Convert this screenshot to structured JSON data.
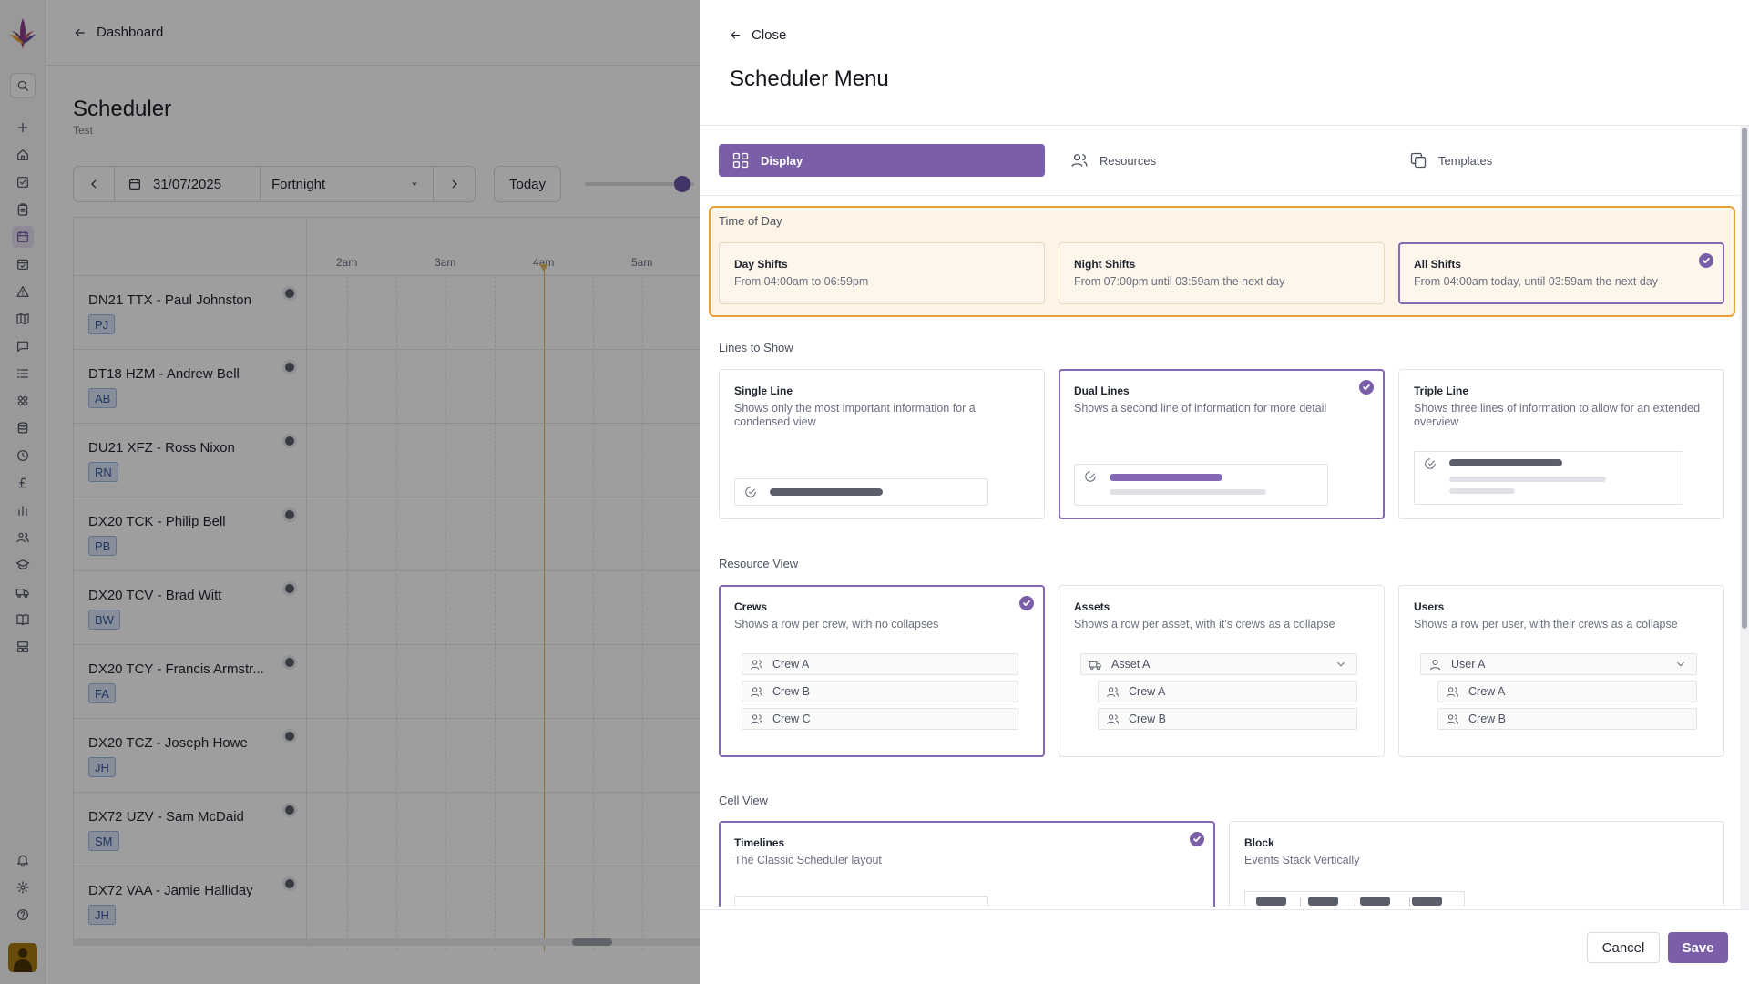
{
  "nav": {
    "back_label": "Dashboard"
  },
  "scheduler": {
    "title": "Scheduler",
    "subtitle": "Test",
    "date": "31/07/2025",
    "range": "Fortnight",
    "today_label": "Today",
    "hours": [
      "2am",
      "3am",
      "4am",
      "5am"
    ],
    "rows": [
      {
        "name": "DN21 TTX - Paul Johnston",
        "initials": "PJ"
      },
      {
        "name": "DT18 HZM - Andrew Bell",
        "initials": "AB"
      },
      {
        "name": "DU21 XFZ - Ross Nixon",
        "initials": "RN"
      },
      {
        "name": "DX20 TCK - Philip Bell",
        "initials": "PB"
      },
      {
        "name": "DX20 TCV - Brad Witt",
        "initials": "BW"
      },
      {
        "name": "DX20 TCY - Francis Armstr...",
        "initials": "FA"
      },
      {
        "name": "DX20 TCZ - Joseph Howe",
        "initials": "JH"
      },
      {
        "name": "DX72 UZV - Sam McDaid",
        "initials": "SM"
      },
      {
        "name": "DX72 VAA - Jamie Halliday",
        "initials": "JH"
      }
    ]
  },
  "menu": {
    "close_label": "Close",
    "title": "Scheduler Menu",
    "tabs": [
      {
        "label": "Display",
        "icon": "grid-icon",
        "active": true
      },
      {
        "label": "Resources",
        "icon": "users-icon",
        "active": false
      },
      {
        "label": "Templates",
        "icon": "copy-icon",
        "active": false
      }
    ],
    "time_of_day": {
      "label": "Time of Day",
      "options": [
        {
          "title": "Day Shifts",
          "desc": "From 04:00am to 06:59pm",
          "selected": false
        },
        {
          "title": "Night Shifts",
          "desc": "From 07:00pm until 03:59am the next day",
          "selected": false
        },
        {
          "title": "All Shifts",
          "desc": "From 04:00am today, until 03:59am the next day",
          "selected": true
        }
      ]
    },
    "lines": {
      "label": "Lines to Show",
      "options": [
        {
          "title": "Single Line",
          "desc": "Shows only the most important information for a condensed view",
          "selected": false
        },
        {
          "title": "Dual Lines",
          "desc": "Shows a second line of information for more detail",
          "selected": true
        },
        {
          "title": "Triple Line",
          "desc": "Shows three lines of information to allow for an extended overview",
          "selected": false
        }
      ]
    },
    "resource_view": {
      "label": "Resource View",
      "options": [
        {
          "title": "Crews",
          "desc": "Shows a row per crew, with no collapses",
          "selected": true,
          "items": [
            "Crew A",
            "Crew B",
            "Crew C"
          ]
        },
        {
          "title": "Assets",
          "desc": "Shows a row per asset, with it's crews as a collapse",
          "selected": false,
          "parent": "Asset A",
          "items": [
            "Crew A",
            "Crew B"
          ]
        },
        {
          "title": "Users",
          "desc": "Shows a row per user, with their crews as a collapse",
          "selected": false,
          "parent": "User A",
          "items": [
            "Crew A",
            "Crew B"
          ]
        }
      ]
    },
    "cell_view": {
      "label": "Cell View",
      "options": [
        {
          "title": "Timelines",
          "desc": "The Classic Scheduler layout",
          "selected": true
        },
        {
          "title": "Block",
          "desc": "Events Stack Vertically",
          "selected": false
        }
      ]
    },
    "cancel_label": "Cancel",
    "save_label": "Save"
  },
  "colors": {
    "accent": "#7b5ea8",
    "highlight_border": "#e7a13a",
    "highlight_bg": "#fef4e6"
  }
}
